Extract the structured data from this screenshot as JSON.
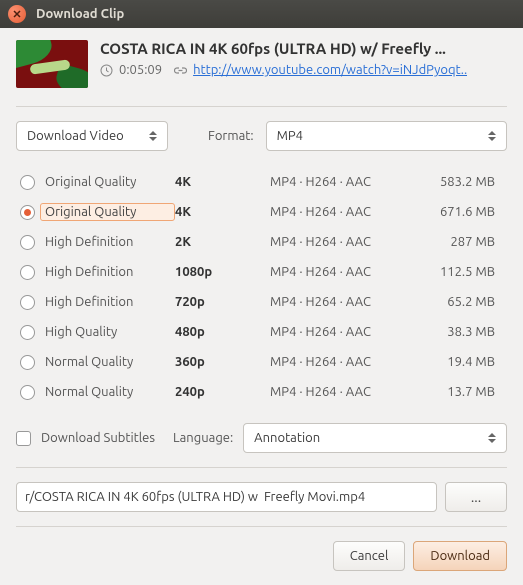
{
  "window": {
    "title": "Download Clip"
  },
  "video": {
    "title": "COSTA RICA IN 4K 60fps (ULTRA HD) w/ Freefly ...",
    "duration": "0:05:09",
    "url": "http://www.youtube.com/watch?v=iNJdPyoqt.."
  },
  "controls": {
    "download_mode": "Download Video",
    "format_label": "Format:",
    "format_value": "MP4"
  },
  "qualities": [
    {
      "name": "Original Quality",
      "res": "4K",
      "codec": "MP4 · H264 · AAC",
      "size": "583.2 MB",
      "checked": false
    },
    {
      "name": "Original Quality",
      "res": "4K",
      "codec": "MP4 · H264 · AAC",
      "size": "671.6 MB",
      "checked": true
    },
    {
      "name": "High Definition",
      "res": "2K",
      "codec": "MP4 · H264 · AAC",
      "size": "287 MB",
      "checked": false
    },
    {
      "name": "High Definition",
      "res": "1080p",
      "codec": "MP4 · H264 · AAC",
      "size": "112.5 MB",
      "checked": false
    },
    {
      "name": "High Definition",
      "res": "720p",
      "codec": "MP4 · H264 · AAC",
      "size": "65.2 MB",
      "checked": false
    },
    {
      "name": "High Quality",
      "res": "480p",
      "codec": "MP4 · H264 · AAC",
      "size": "38.3 MB",
      "checked": false
    },
    {
      "name": "Normal Quality",
      "res": "360p",
      "codec": "MP4 · H264 · AAC",
      "size": "19.4 MB",
      "checked": false
    },
    {
      "name": "Normal Quality",
      "res": "240p",
      "codec": "MP4 · H264 · AAC",
      "size": "13.7 MB",
      "checked": false
    }
  ],
  "subtitles": {
    "checkbox_label": "Download Subtitles",
    "language_label": "Language:",
    "language_value": "Annotation"
  },
  "path": {
    "value": "r/COSTA RICA IN 4K 60fps (ULTRA HD) w  Freefly Movi.mp4",
    "browse_label": "..."
  },
  "footer": {
    "cancel": "Cancel",
    "download": "Download"
  }
}
